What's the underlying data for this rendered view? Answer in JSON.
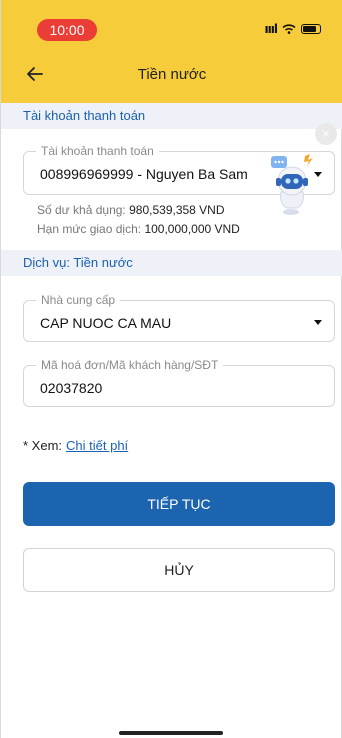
{
  "status_bar": {
    "time": "10:00",
    "signal": "ıııl"
  },
  "header": {
    "title": "Tiền nước"
  },
  "account_section": {
    "title": "Tài khoản thanh toán",
    "field_label": "Tài khoản thanh toán",
    "field_value": "008996969999 - Nguyen Ba Sam",
    "balance_label": "Số dư khả dụng:",
    "balance_value": "980,539,358 VND",
    "limit_label": "Hạn mức giao dịch:",
    "limit_value": "100,000,000 VND"
  },
  "service_section": {
    "title": "Dịch vụ: Tiền nước",
    "provider_label": "Nhà cung cấp",
    "provider_value": "CAP NUOC CA MAU",
    "customer_label": "Mã hoá đơn/Mã khách hàng/SĐT",
    "customer_value": "02037820"
  },
  "fee_note": {
    "prefix": "* Xem:",
    "link": "Chi tiết phí"
  },
  "buttons": {
    "continue": "TIẾP TỤC",
    "cancel": "HỦY"
  },
  "assistant": {
    "close": "×"
  },
  "colors": {
    "header_bg": "#f7cc3a",
    "primary": "#1c64b0",
    "time_pill": "#ea3d35",
    "section_text": "#1b5fb1"
  }
}
